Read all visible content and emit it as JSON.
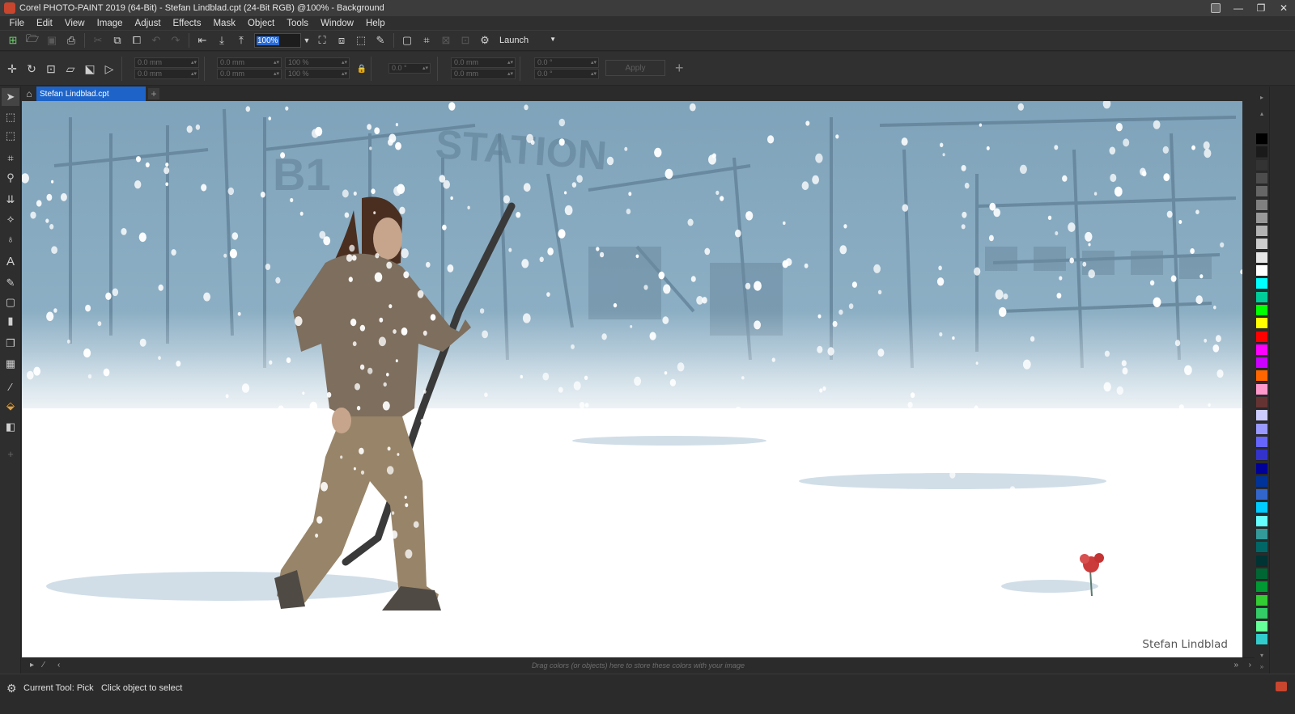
{
  "window": {
    "title": "Corel PHOTO-PAINT 2019 (64-Bit) - Stefan Lindblad.cpt (24-Bit RGB) @100% - Background",
    "controls": [
      "—",
      "❐",
      "✕"
    ]
  },
  "menu": [
    "File",
    "Edit",
    "View",
    "Image",
    "Adjust",
    "Effects",
    "Mask",
    "Object",
    "Tools",
    "Window",
    "Help"
  ],
  "toolbar": {
    "zoom_value": "100%",
    "launch_label": "Launch"
  },
  "propbar": {
    "pos_x": "0.0 mm",
    "pos_y": "0.0 mm",
    "size_w": "0.0 mm",
    "size_h": "0.0 mm",
    "scale_x": "100 %",
    "scale_y": "100 %",
    "angle": "0.0 °",
    "center_x": "0.0 mm",
    "center_y": "0.0 mm",
    "skew_x": "0.0 °",
    "skew_y": "0.0 °",
    "apply_label": "Apply"
  },
  "tabs": {
    "document": "Stefan Lindblad.cpt"
  },
  "canvas": {
    "signature": "Stefan Lindblad"
  },
  "tray": {
    "hint": "Drag colors (or objects) here to store these colors with your image"
  },
  "status": {
    "current_tool": "Current Tool: Pick",
    "hint": "Click object to select"
  },
  "palette_colors": [
    "#000000",
    "#1a1a1a",
    "#333333",
    "#4d4d4d",
    "#666666",
    "#808080",
    "#999999",
    "#b3b3b3",
    "#cccccc",
    "#e6e6e6",
    "#ffffff",
    "#00ffff",
    "#00cc99",
    "#00ff00",
    "#ffff00",
    "#ff0000",
    "#ff00ff",
    "#cc00ff",
    "#ff6600",
    "#ff99cc",
    "#663333",
    "#ccccff",
    "#9999ff",
    "#6666ff",
    "#3333cc",
    "#000099",
    "#003399",
    "#3366cc",
    "#00ccff",
    "#66ffff",
    "#339999",
    "#006666",
    "#003333",
    "#006633",
    "#009933",
    "#33cc33",
    "#33cc66",
    "#66ff99",
    "#33cccc"
  ]
}
